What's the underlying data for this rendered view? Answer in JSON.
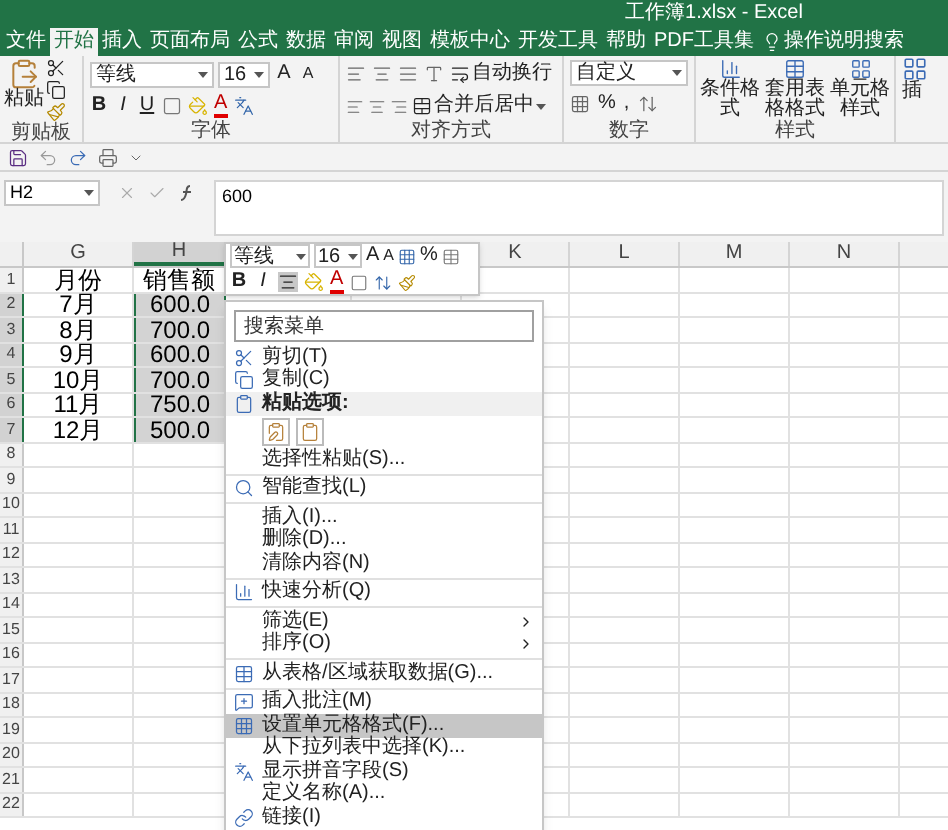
{
  "title": "工作簿1.xlsx  -  Excel",
  "tabs": [
    {
      "label": "文件",
      "selected": false
    },
    {
      "label": "开始",
      "selected": true
    },
    {
      "label": "插入",
      "selected": false
    },
    {
      "label": "页面布局",
      "selected": false
    },
    {
      "label": "公式",
      "selected": false
    },
    {
      "label": "数据",
      "selected": false
    },
    {
      "label": "审阅",
      "selected": false
    },
    {
      "label": "视图",
      "selected": false
    },
    {
      "label": "模板中心",
      "selected": false
    },
    {
      "label": "开发工具",
      "selected": false
    },
    {
      "label": "帮助",
      "selected": false
    },
    {
      "label": "PDF工具集",
      "selected": false
    }
  ],
  "tell_me": "操作说明搜索",
  "ribbon": {
    "clipboard": {
      "paste": "粘贴",
      "label": "剪贴板"
    },
    "font": {
      "font": "等线",
      "size": "16",
      "grow": "A",
      "shrink": "A",
      "buttons": [
        "B",
        "I",
        "U"
      ],
      "font_color": "A",
      "label": "字体"
    },
    "alignment": {
      "wrap": "自动换行",
      "merge": "合并后居中",
      "label": "对齐方式"
    },
    "number": {
      "format": "自定义",
      "percent": "%",
      "comma": ",",
      "label": "数字"
    },
    "styles": {
      "buttons": [
        "条件格式",
        "套用表格格式",
        "单元格样式"
      ],
      "label": "样式"
    },
    "cut_off": "插"
  },
  "name_box": "H2",
  "formula": "600",
  "sheet": {
    "columns": [
      {
        "label": "G",
        "selected": false
      },
      {
        "label": "H",
        "selected": true
      },
      {
        "label": "K",
        "selected": false
      },
      {
        "label": "L",
        "selected": false
      },
      {
        "label": "M",
        "selected": false
      },
      {
        "label": "N",
        "selected": false
      }
    ],
    "rows": [
      {
        "num": "1",
        "selected": false,
        "cells": [
          {
            "text": "月份",
            "selected": false
          },
          {
            "text": "销售额",
            "selected": false
          }
        ]
      },
      {
        "num": "2",
        "selected": true,
        "cells": [
          {
            "text": "7月",
            "selected": false
          },
          {
            "text": "600.0",
            "selected": true
          }
        ]
      },
      {
        "num": "3",
        "selected": true,
        "cells": [
          {
            "text": "8月",
            "selected": false
          },
          {
            "text": "700.0",
            "selected": true
          }
        ]
      },
      {
        "num": "4",
        "selected": true,
        "cells": [
          {
            "text": "9月",
            "selected": false
          },
          {
            "text": "600.0",
            "selected": true
          }
        ]
      },
      {
        "num": "5",
        "selected": true,
        "cells": [
          {
            "text": "10月",
            "selected": false
          },
          {
            "text": "700.0",
            "selected": true
          }
        ]
      },
      {
        "num": "6",
        "selected": true,
        "cells": [
          {
            "text": "11月",
            "selected": false
          },
          {
            "text": "750.0",
            "selected": true
          }
        ]
      },
      {
        "num": "7",
        "selected": true,
        "cells": [
          {
            "text": "12月",
            "selected": false
          },
          {
            "text": "500.0",
            "selected": true
          }
        ]
      },
      {
        "num": "8",
        "selected": false
      },
      {
        "num": "9",
        "selected": false
      },
      {
        "num": "10",
        "selected": false
      },
      {
        "num": "11",
        "selected": false
      },
      {
        "num": "12",
        "selected": false
      },
      {
        "num": "13",
        "selected": false
      },
      {
        "num": "14",
        "selected": false
      },
      {
        "num": "15",
        "selected": false
      },
      {
        "num": "16",
        "selected": false
      },
      {
        "num": "17",
        "selected": false
      },
      {
        "num": "18",
        "selected": false
      },
      {
        "num": "19",
        "selected": false
      },
      {
        "num": "20",
        "selected": false
      },
      {
        "num": "21",
        "selected": false
      },
      {
        "num": "22",
        "selected": false
      }
    ]
  },
  "mini_toolbar": {
    "font": "等线",
    "size": "16",
    "grow": "A",
    "shrink": "A",
    "percent": "%",
    "buttons": [
      "B",
      "I"
    ],
    "font_color": "A"
  },
  "menu": {
    "search_placeholder": "搜索菜单",
    "sections": [
      [
        {
          "kind": "item",
          "label": "剪切(T)",
          "selected": false
        },
        {
          "kind": "item",
          "label": "复制(C)",
          "selected": false
        },
        {
          "kind": "header",
          "label": "粘贴选项:"
        },
        {
          "kind": "paste_options"
        },
        {
          "kind": "item",
          "label": "选择性粘贴(S)...",
          "selected": false
        }
      ],
      [
        {
          "kind": "item",
          "label": "智能查找(L)",
          "selected": false
        }
      ],
      [
        {
          "kind": "item",
          "label": "插入(I)...",
          "selected": false
        },
        {
          "kind": "item",
          "label": "删除(D)...",
          "selected": false
        },
        {
          "kind": "item",
          "label": "清除内容(N)",
          "selected": false
        }
      ],
      [
        {
          "kind": "item",
          "label": "快速分析(Q)",
          "selected": false
        }
      ],
      [
        {
          "kind": "submenu",
          "label": "筛选(E)",
          "selected": false
        },
        {
          "kind": "submenu",
          "label": "排序(O)",
          "selected": false
        }
      ],
      [
        {
          "kind": "item",
          "label": "从表格/区域获取数据(G)...",
          "selected": false
        }
      ],
      [
        {
          "kind": "item",
          "label": "插入批注(M)",
          "selected": false
        },
        {
          "kind": "item",
          "label": "设置单元格格式(F)...",
          "selected": true
        },
        {
          "kind": "item",
          "label": "从下拉列表中选择(K)...",
          "selected": false
        },
        {
          "kind": "item",
          "label": "显示拼音字段(S)",
          "selected": false
        },
        {
          "kind": "item",
          "label": "定义名称(A)...",
          "selected": false
        },
        {
          "kind": "item",
          "label": "链接(I)",
          "selected": false
        }
      ]
    ]
  }
}
